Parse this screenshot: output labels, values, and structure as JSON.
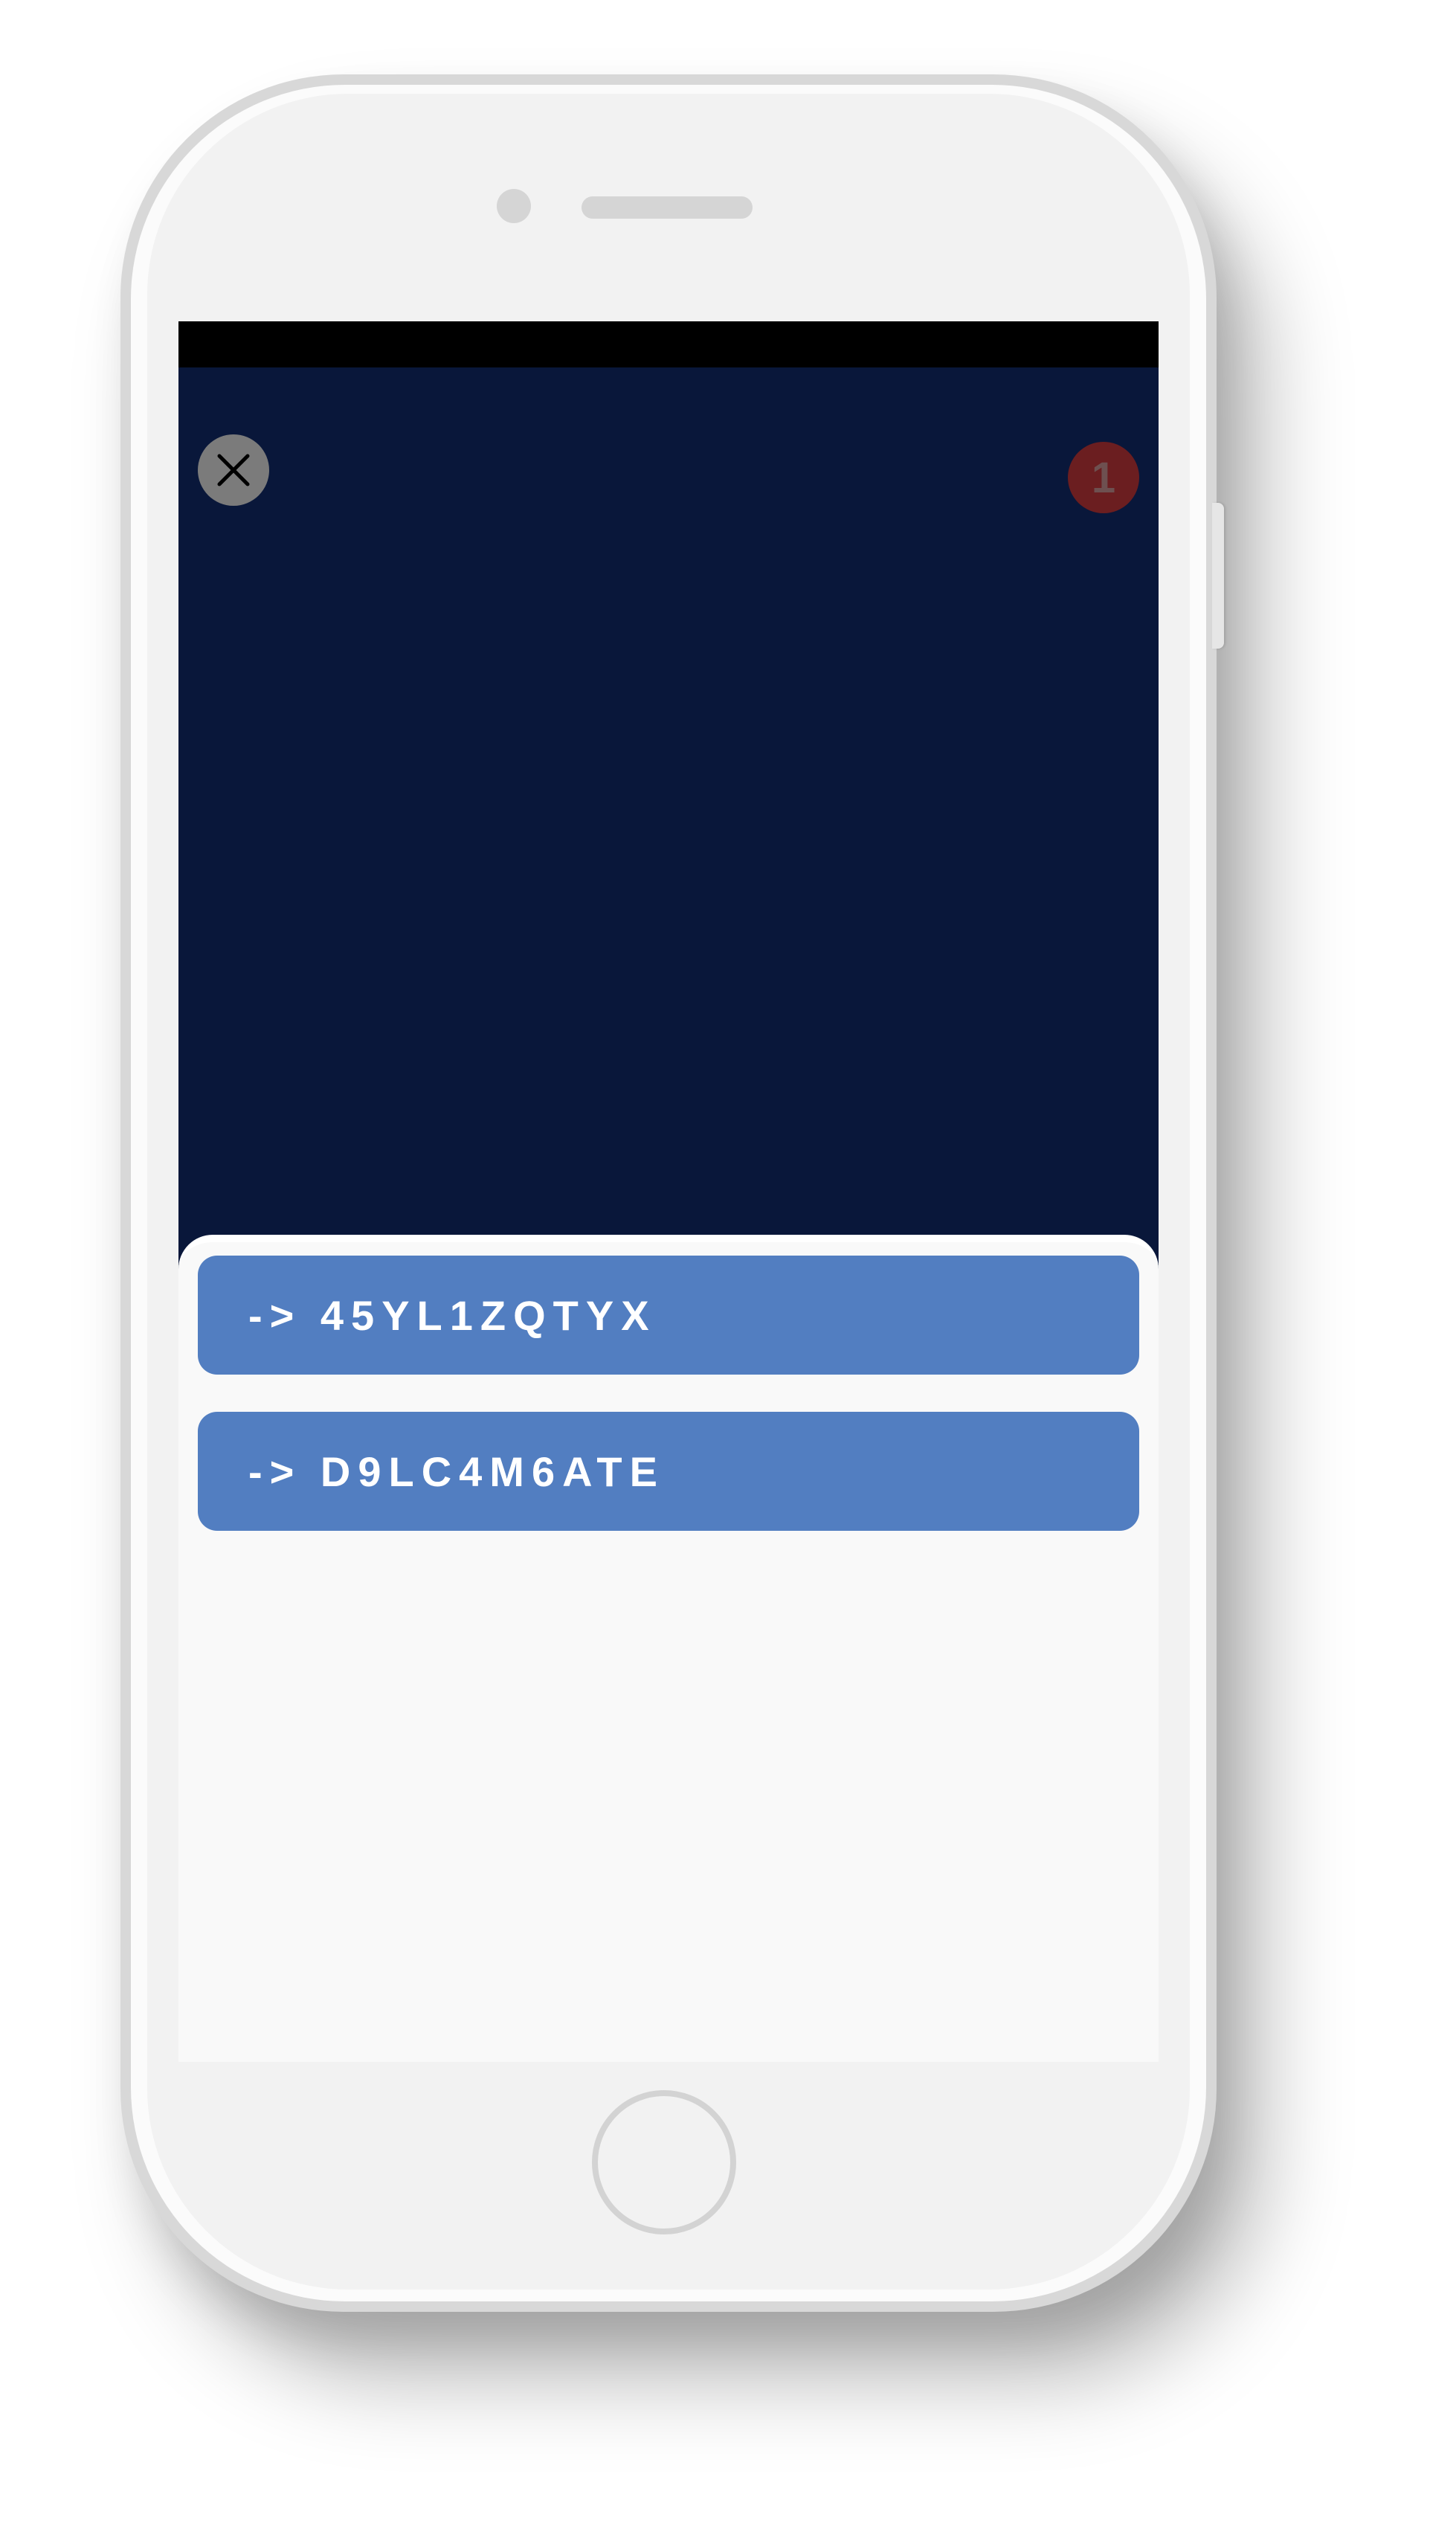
{
  "story": {
    "close_icon": "close-icon",
    "counter": "1",
    "illustration": "gift-box-icon"
  },
  "codes": [
    {
      "label": "-> 45YL1ZQTYX"
    },
    {
      "label": "-> D9LC4M6ATE"
    }
  ],
  "colors": {
    "story_background": "#09173a",
    "button_background": "#527ec1",
    "button_text": "#ffffff",
    "counter_badge": "#6b1e20",
    "close_button": "#7b7b7b",
    "ribbon": "#a8451f",
    "gift_box": "#7e7e7e"
  }
}
